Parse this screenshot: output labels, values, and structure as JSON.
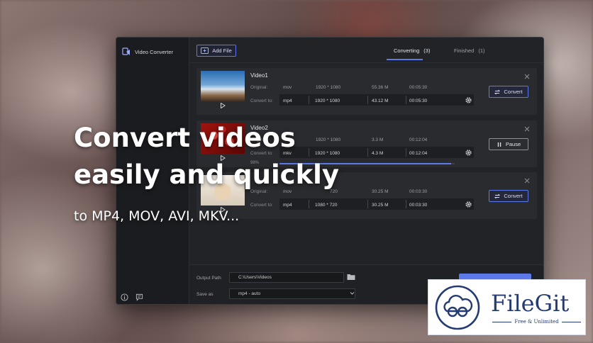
{
  "app": {
    "title": "Video Converter"
  },
  "toolbar": {
    "add_file_label": "Add File"
  },
  "tabs": [
    {
      "label": "Converting",
      "count": "(3)",
      "active": true
    },
    {
      "label": "Finished",
      "count": "(1)",
      "active": false
    }
  ],
  "labels": {
    "original": "Original:",
    "convert_to": "Convert to:"
  },
  "videos": [
    {
      "name": "Video1",
      "original": {
        "format": "mov",
        "resolution": "1920 * 1080",
        "size": "55.36 M",
        "duration": "00:05:30"
      },
      "target": {
        "format": "mp4",
        "resolution": "1920 * 1080",
        "size": "43.12 M",
        "duration": "00:05:30"
      },
      "action_label": "Convert"
    },
    {
      "name": "Video2",
      "original": {
        "format": "",
        "resolution": "1920 * 1080",
        "size": "3.3 M",
        "duration": "00:12:04"
      },
      "target": {
        "format": "mkv",
        "resolution": "1920 * 1080",
        "size": "4.3 M",
        "duration": "00:12:04"
      },
      "action_label": "Pause",
      "progress_text": "98%",
      "progress": 0.98
    },
    {
      "name": "",
      "original": {
        "format": "mov",
        "resolution": "720",
        "size": "30.25 M",
        "duration": "00:03:30"
      },
      "target": {
        "format": "mp4",
        "resolution": "1080 * 720",
        "size": "30.25 M",
        "duration": "00:03:30"
      },
      "action_label": "Convert"
    }
  ],
  "bottom": {
    "output_path_label": "Output Path",
    "output_path_value": "C:\\Users\\Videos",
    "save_as_label": "Save as",
    "save_as_value": "mp4 - auto"
  },
  "overlay": {
    "headline_line1": "Convert videos",
    "headline_line2": "easily and quickly",
    "subline": "to MP4, MOV, AVI, MKV..."
  },
  "badge": {
    "brand": "FileGit",
    "tagline": "Free & Unlimited"
  },
  "colors": {
    "accent": "#5b79e8",
    "window_bg": "#222326",
    "brand": "#233a73"
  },
  "icons": [
    "app-logo-icon",
    "add-file-icon",
    "play-icon",
    "gear-icon",
    "close-icon",
    "convert-icon",
    "pause-icon",
    "folder-icon",
    "chevron-down-icon",
    "info-icon",
    "feedback-icon",
    "filegit-logo-icon"
  ]
}
